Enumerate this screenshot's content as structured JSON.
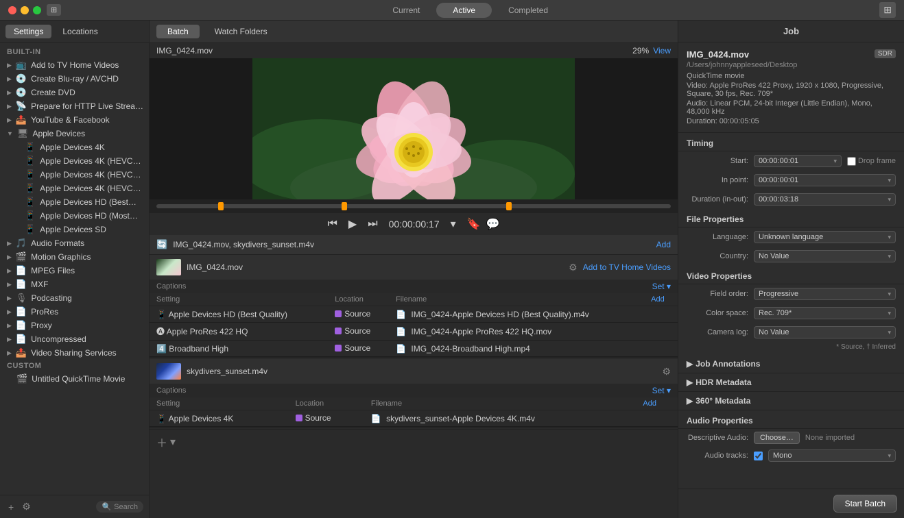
{
  "titlebar": {
    "tabs": [
      {
        "label": "Current",
        "active": false
      },
      {
        "label": "Active",
        "active": true
      },
      {
        "label": "Completed",
        "active": false
      }
    ]
  },
  "sidebar": {
    "tabs": [
      {
        "label": "Settings",
        "active": true
      },
      {
        "label": "Locations",
        "active": false
      }
    ],
    "built_in_header": "BUILT-IN",
    "custom_header": "CUSTOM",
    "items": [
      {
        "label": "Add to TV Home Videos",
        "indent": 1,
        "icon": "📺"
      },
      {
        "label": "Create Blu-ray / AVCHD",
        "indent": 1,
        "icon": "💿"
      },
      {
        "label": "Create DVD",
        "indent": 1,
        "icon": "💿"
      },
      {
        "label": "Prepare for HTTP Live Strea…",
        "indent": 1,
        "icon": "📡"
      },
      {
        "label": "YouTube & Facebook",
        "indent": 1,
        "icon": "📤"
      },
      {
        "label": "Apple Devices",
        "indent": 0,
        "icon": "📱",
        "expanded": true
      },
      {
        "label": "Apple Devices 4K",
        "indent": 2
      },
      {
        "label": "Apple Devices 4K (HEVC…",
        "indent": 2
      },
      {
        "label": "Apple Devices 4K (HEVC…",
        "indent": 2
      },
      {
        "label": "Apple Devices 4K (HEVC…",
        "indent": 2
      },
      {
        "label": "Apple Devices HD (Best…",
        "indent": 2
      },
      {
        "label": "Apple Devices HD (Most…",
        "indent": 2
      },
      {
        "label": "Apple Devices SD",
        "indent": 2
      },
      {
        "label": "Audio Formats",
        "indent": 0,
        "icon": "🎵"
      },
      {
        "label": "Motion Graphics",
        "indent": 0,
        "icon": "🎬"
      },
      {
        "label": "MPEG Files",
        "indent": 0,
        "icon": "📄"
      },
      {
        "label": "MXF",
        "indent": 0,
        "icon": "📄"
      },
      {
        "label": "Podcasting",
        "indent": 0,
        "icon": "🎙"
      },
      {
        "label": "ProRes",
        "indent": 0,
        "icon": "📄"
      },
      {
        "label": "Proxy",
        "indent": 0,
        "icon": "📄"
      },
      {
        "label": "Uncompressed",
        "indent": 0,
        "icon": "📄"
      },
      {
        "label": "Video Sharing Services",
        "indent": 0,
        "icon": "📤"
      },
      {
        "label": "Untitled QuickTime Movie",
        "indent": 1,
        "icon": "🎬"
      }
    ],
    "footer": {
      "add_label": "+",
      "gear_label": "⚙",
      "search_placeholder": "Search"
    }
  },
  "center": {
    "batch_tabs": [
      {
        "label": "Batch",
        "active": true
      },
      {
        "label": "Watch Folders",
        "active": false
      }
    ],
    "video_title": "IMG_0424.mov",
    "zoom": "29%",
    "view": "View",
    "timecode": "00:00:00:17",
    "batch_header": {
      "files": "IMG_0424.mov, skydivers_sunset.m4v",
      "add_label": "Add"
    },
    "files": [
      {
        "name": "IMG_0424.mov",
        "action": "Add to TV Home Videos",
        "captions_header": "Captions",
        "set_label": "Set ▾",
        "columns": [
          "Setting",
          "Location",
          "Filename"
        ],
        "add_col": "Add",
        "rows": [
          {
            "setting": "Apple Devices HD (Best Quality)",
            "location": "Source",
            "filename": "IMG_0424-Apple Devices HD (Best Quality).m4v",
            "icon": "📱"
          },
          {
            "setting": "Apple ProRes 422 HQ",
            "location": "Source",
            "filename": "IMG_0424-Apple ProRes 422 HQ.mov",
            "icon": "🅐"
          },
          {
            "setting": "Broadband High",
            "location": "Source",
            "filename": "IMG_0424-Broadband High.mp4",
            "icon": "4️"
          }
        ]
      },
      {
        "name": "skydivers_sunset.m4v",
        "action": "",
        "captions_header": "Captions",
        "set_label": "Set ▾",
        "columns": [
          "Setting",
          "Location",
          "Filename"
        ],
        "add_col": "Add",
        "rows": [
          {
            "setting": "Apple Devices 4K",
            "location": "Source",
            "filename": "skydivers_sunset-Apple Devices 4K.m4v",
            "icon": "📱"
          }
        ]
      }
    ],
    "start_batch_label": "Start Batch"
  },
  "right": {
    "title": "Job",
    "filename": "IMG_0424.mov",
    "sdr_badge": "SDR",
    "path": "/Users/johnnyappleseed/Desktop",
    "type": "QuickTime movie",
    "video_info": "Video: Apple ProRes 422 Proxy, 1920 x 1080, Progressive, Square, 30 fps, Rec. 709*",
    "audio_info": "Audio: Linear PCM, 24-bit Integer (Little Endian), Mono, 48,000 kHz",
    "duration": "Duration: 00:00:05:05",
    "timing": {
      "title": "Timing",
      "start_label": "Start:",
      "start_value": "00:00:00:01",
      "inpoint_label": "In point:",
      "inpoint_value": "00:00:00:01",
      "duration_label": "Duration (in-out):",
      "duration_value": "00:00:03:18",
      "drop_frame_label": "Drop frame"
    },
    "file_properties": {
      "title": "File Properties",
      "language_label": "Language:",
      "language_value": "Unknown language",
      "country_label": "Country:",
      "country_value": "No Value"
    },
    "video_properties": {
      "title": "Video Properties",
      "field_order_label": "Field order:",
      "field_order_value": "Progressive",
      "color_space_label": "Color space:",
      "color_space_value": "Rec. 709*",
      "camera_log_label": "Camera log:",
      "camera_log_value": "No Value",
      "note": "* Source, † Inferred"
    },
    "job_annotations": "Job Annotations",
    "hdr_metadata": "HDR Metadata",
    "360_metadata": "360° Metadata",
    "audio_properties": {
      "title": "Audio Properties",
      "descriptive_label": "Descriptive Audio:",
      "choose_label": "Choose…",
      "none_imported": "None imported",
      "tracks_label": "Audio tracks:",
      "tracks_value": "Mono"
    }
  }
}
